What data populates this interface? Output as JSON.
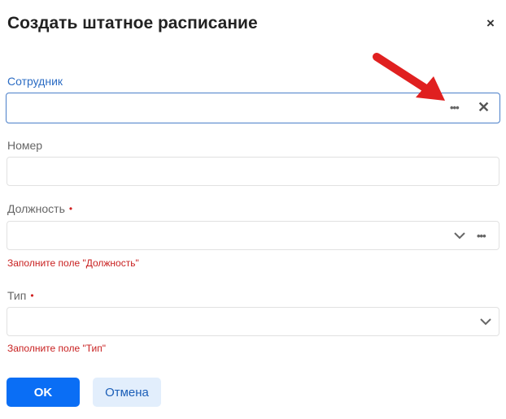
{
  "dialog": {
    "title": "Создать штатное расписание",
    "close_glyph": "×"
  },
  "fields": {
    "employee": {
      "label": "Сотрудник",
      "value": "",
      "icons": [
        "more-dots-icon",
        "clear-icon"
      ]
    },
    "number": {
      "label": "Номер",
      "value": ""
    },
    "position": {
      "label": "Должность",
      "required_mark": "•",
      "value": "",
      "error": "Заполните поле \"Должность\"",
      "icons": [
        "chevron-down-icon",
        "more-dots-icon"
      ]
    },
    "type": {
      "label": "Тип",
      "required_mark": "•",
      "value": "",
      "error": "Заполните поле \"Тип\"",
      "icons": [
        "chevron-down-icon"
      ]
    }
  },
  "buttons": {
    "ok": "OK",
    "cancel": "Отмена"
  },
  "glyphs": {
    "dots": "•••",
    "clear": "✕"
  },
  "colors": {
    "primary": "#0a6ef5",
    "error": "#c81f1f",
    "focus_border": "#4a7fc9",
    "annotation_arrow": "#e02020"
  }
}
